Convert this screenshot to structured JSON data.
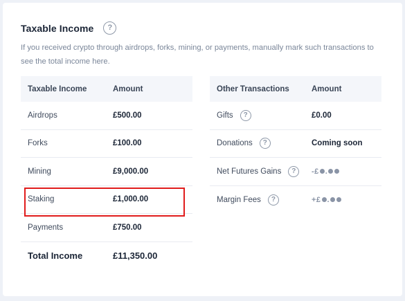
{
  "section": {
    "title": "Taxable Income",
    "help_icon": "question-circle-icon",
    "description": "If you received crypto through airdrops, forks, mining, or payments, manually mark such transactions to see the total income here."
  },
  "income_table": {
    "headers": [
      "Taxable Income",
      "Amount"
    ],
    "rows": [
      {
        "label": "Airdrops",
        "amount": "£500.00"
      },
      {
        "label": "Forks",
        "amount": "£100.00"
      },
      {
        "label": "Mining",
        "amount": "£9,000.00"
      },
      {
        "label": "Staking",
        "amount": "£1,000.00"
      },
      {
        "label": "Payments",
        "amount": "£750.00"
      }
    ],
    "total": {
      "label": "Total Income",
      "amount": "£11,350.00"
    },
    "highlighted_row": "Staking",
    "highlight_color": "#e01b1b"
  },
  "other_table": {
    "headers": [
      "Other Transactions",
      "Amount"
    ],
    "rows": [
      {
        "label": "Gifts",
        "amount": "£0.00"
      },
      {
        "label": "Donations",
        "amount": "Coming soon"
      },
      {
        "label": "Net Futures Gains",
        "amount_prefix": "-£",
        "masked": true
      },
      {
        "label": "Margin Fees",
        "amount_prefix": "+£",
        "masked": true
      }
    ]
  }
}
